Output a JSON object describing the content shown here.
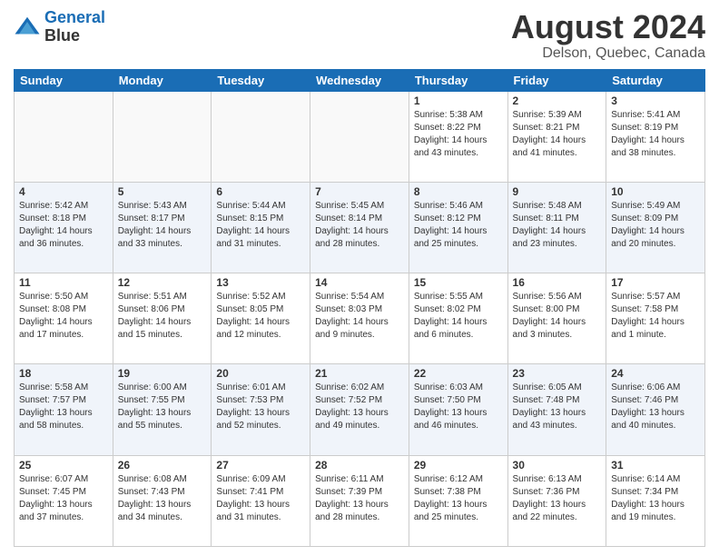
{
  "header": {
    "logo_line1": "General",
    "logo_line2": "Blue",
    "title": "August 2024",
    "subtitle": "Delson, Quebec, Canada"
  },
  "days_of_week": [
    "Sunday",
    "Monday",
    "Tuesday",
    "Wednesday",
    "Thursday",
    "Friday",
    "Saturday"
  ],
  "weeks": [
    [
      {
        "day": "",
        "sunrise": "",
        "sunset": "",
        "daylight": "",
        "empty": true
      },
      {
        "day": "",
        "sunrise": "",
        "sunset": "",
        "daylight": "",
        "empty": true
      },
      {
        "day": "",
        "sunrise": "",
        "sunset": "",
        "daylight": "",
        "empty": true
      },
      {
        "day": "",
        "sunrise": "",
        "sunset": "",
        "daylight": "",
        "empty": true
      },
      {
        "day": "1",
        "sunrise": "Sunrise: 5:38 AM",
        "sunset": "Sunset: 8:22 PM",
        "daylight": "Daylight: 14 hours and 43 minutes."
      },
      {
        "day": "2",
        "sunrise": "Sunrise: 5:39 AM",
        "sunset": "Sunset: 8:21 PM",
        "daylight": "Daylight: 14 hours and 41 minutes."
      },
      {
        "day": "3",
        "sunrise": "Sunrise: 5:41 AM",
        "sunset": "Sunset: 8:19 PM",
        "daylight": "Daylight: 14 hours and 38 minutes."
      }
    ],
    [
      {
        "day": "4",
        "sunrise": "Sunrise: 5:42 AM",
        "sunset": "Sunset: 8:18 PM",
        "daylight": "Daylight: 14 hours and 36 minutes."
      },
      {
        "day": "5",
        "sunrise": "Sunrise: 5:43 AM",
        "sunset": "Sunset: 8:17 PM",
        "daylight": "Daylight: 14 hours and 33 minutes."
      },
      {
        "day": "6",
        "sunrise": "Sunrise: 5:44 AM",
        "sunset": "Sunset: 8:15 PM",
        "daylight": "Daylight: 14 hours and 31 minutes."
      },
      {
        "day": "7",
        "sunrise": "Sunrise: 5:45 AM",
        "sunset": "Sunset: 8:14 PM",
        "daylight": "Daylight: 14 hours and 28 minutes."
      },
      {
        "day": "8",
        "sunrise": "Sunrise: 5:46 AM",
        "sunset": "Sunset: 8:12 PM",
        "daylight": "Daylight: 14 hours and 25 minutes."
      },
      {
        "day": "9",
        "sunrise": "Sunrise: 5:48 AM",
        "sunset": "Sunset: 8:11 PM",
        "daylight": "Daylight: 14 hours and 23 minutes."
      },
      {
        "day": "10",
        "sunrise": "Sunrise: 5:49 AM",
        "sunset": "Sunset: 8:09 PM",
        "daylight": "Daylight: 14 hours and 20 minutes."
      }
    ],
    [
      {
        "day": "11",
        "sunrise": "Sunrise: 5:50 AM",
        "sunset": "Sunset: 8:08 PM",
        "daylight": "Daylight: 14 hours and 17 minutes."
      },
      {
        "day": "12",
        "sunrise": "Sunrise: 5:51 AM",
        "sunset": "Sunset: 8:06 PM",
        "daylight": "Daylight: 14 hours and 15 minutes."
      },
      {
        "day": "13",
        "sunrise": "Sunrise: 5:52 AM",
        "sunset": "Sunset: 8:05 PM",
        "daylight": "Daylight: 14 hours and 12 minutes."
      },
      {
        "day": "14",
        "sunrise": "Sunrise: 5:54 AM",
        "sunset": "Sunset: 8:03 PM",
        "daylight": "Daylight: 14 hours and 9 minutes."
      },
      {
        "day": "15",
        "sunrise": "Sunrise: 5:55 AM",
        "sunset": "Sunset: 8:02 PM",
        "daylight": "Daylight: 14 hours and 6 minutes."
      },
      {
        "day": "16",
        "sunrise": "Sunrise: 5:56 AM",
        "sunset": "Sunset: 8:00 PM",
        "daylight": "Daylight: 14 hours and 3 minutes."
      },
      {
        "day": "17",
        "sunrise": "Sunrise: 5:57 AM",
        "sunset": "Sunset: 7:58 PM",
        "daylight": "Daylight: 14 hours and 1 minute."
      }
    ],
    [
      {
        "day": "18",
        "sunrise": "Sunrise: 5:58 AM",
        "sunset": "Sunset: 7:57 PM",
        "daylight": "Daylight: 13 hours and 58 minutes."
      },
      {
        "day": "19",
        "sunrise": "Sunrise: 6:00 AM",
        "sunset": "Sunset: 7:55 PM",
        "daylight": "Daylight: 13 hours and 55 minutes."
      },
      {
        "day": "20",
        "sunrise": "Sunrise: 6:01 AM",
        "sunset": "Sunset: 7:53 PM",
        "daylight": "Daylight: 13 hours and 52 minutes."
      },
      {
        "day": "21",
        "sunrise": "Sunrise: 6:02 AM",
        "sunset": "Sunset: 7:52 PM",
        "daylight": "Daylight: 13 hours and 49 minutes."
      },
      {
        "day": "22",
        "sunrise": "Sunrise: 6:03 AM",
        "sunset": "Sunset: 7:50 PM",
        "daylight": "Daylight: 13 hours and 46 minutes."
      },
      {
        "day": "23",
        "sunrise": "Sunrise: 6:05 AM",
        "sunset": "Sunset: 7:48 PM",
        "daylight": "Daylight: 13 hours and 43 minutes."
      },
      {
        "day": "24",
        "sunrise": "Sunrise: 6:06 AM",
        "sunset": "Sunset: 7:46 PM",
        "daylight": "Daylight: 13 hours and 40 minutes."
      }
    ],
    [
      {
        "day": "25",
        "sunrise": "Sunrise: 6:07 AM",
        "sunset": "Sunset: 7:45 PM",
        "daylight": "Daylight: 13 hours and 37 minutes."
      },
      {
        "day": "26",
        "sunrise": "Sunrise: 6:08 AM",
        "sunset": "Sunset: 7:43 PM",
        "daylight": "Daylight: 13 hours and 34 minutes."
      },
      {
        "day": "27",
        "sunrise": "Sunrise: 6:09 AM",
        "sunset": "Sunset: 7:41 PM",
        "daylight": "Daylight: 13 hours and 31 minutes."
      },
      {
        "day": "28",
        "sunrise": "Sunrise: 6:11 AM",
        "sunset": "Sunset: 7:39 PM",
        "daylight": "Daylight: 13 hours and 28 minutes."
      },
      {
        "day": "29",
        "sunrise": "Sunrise: 6:12 AM",
        "sunset": "Sunset: 7:38 PM",
        "daylight": "Daylight: 13 hours and 25 minutes."
      },
      {
        "day": "30",
        "sunrise": "Sunrise: 6:13 AM",
        "sunset": "Sunset: 7:36 PM",
        "daylight": "Daylight: 13 hours and 22 minutes."
      },
      {
        "day": "31",
        "sunrise": "Sunrise: 6:14 AM",
        "sunset": "Sunset: 7:34 PM",
        "daylight": "Daylight: 13 hours and 19 minutes."
      }
    ]
  ]
}
